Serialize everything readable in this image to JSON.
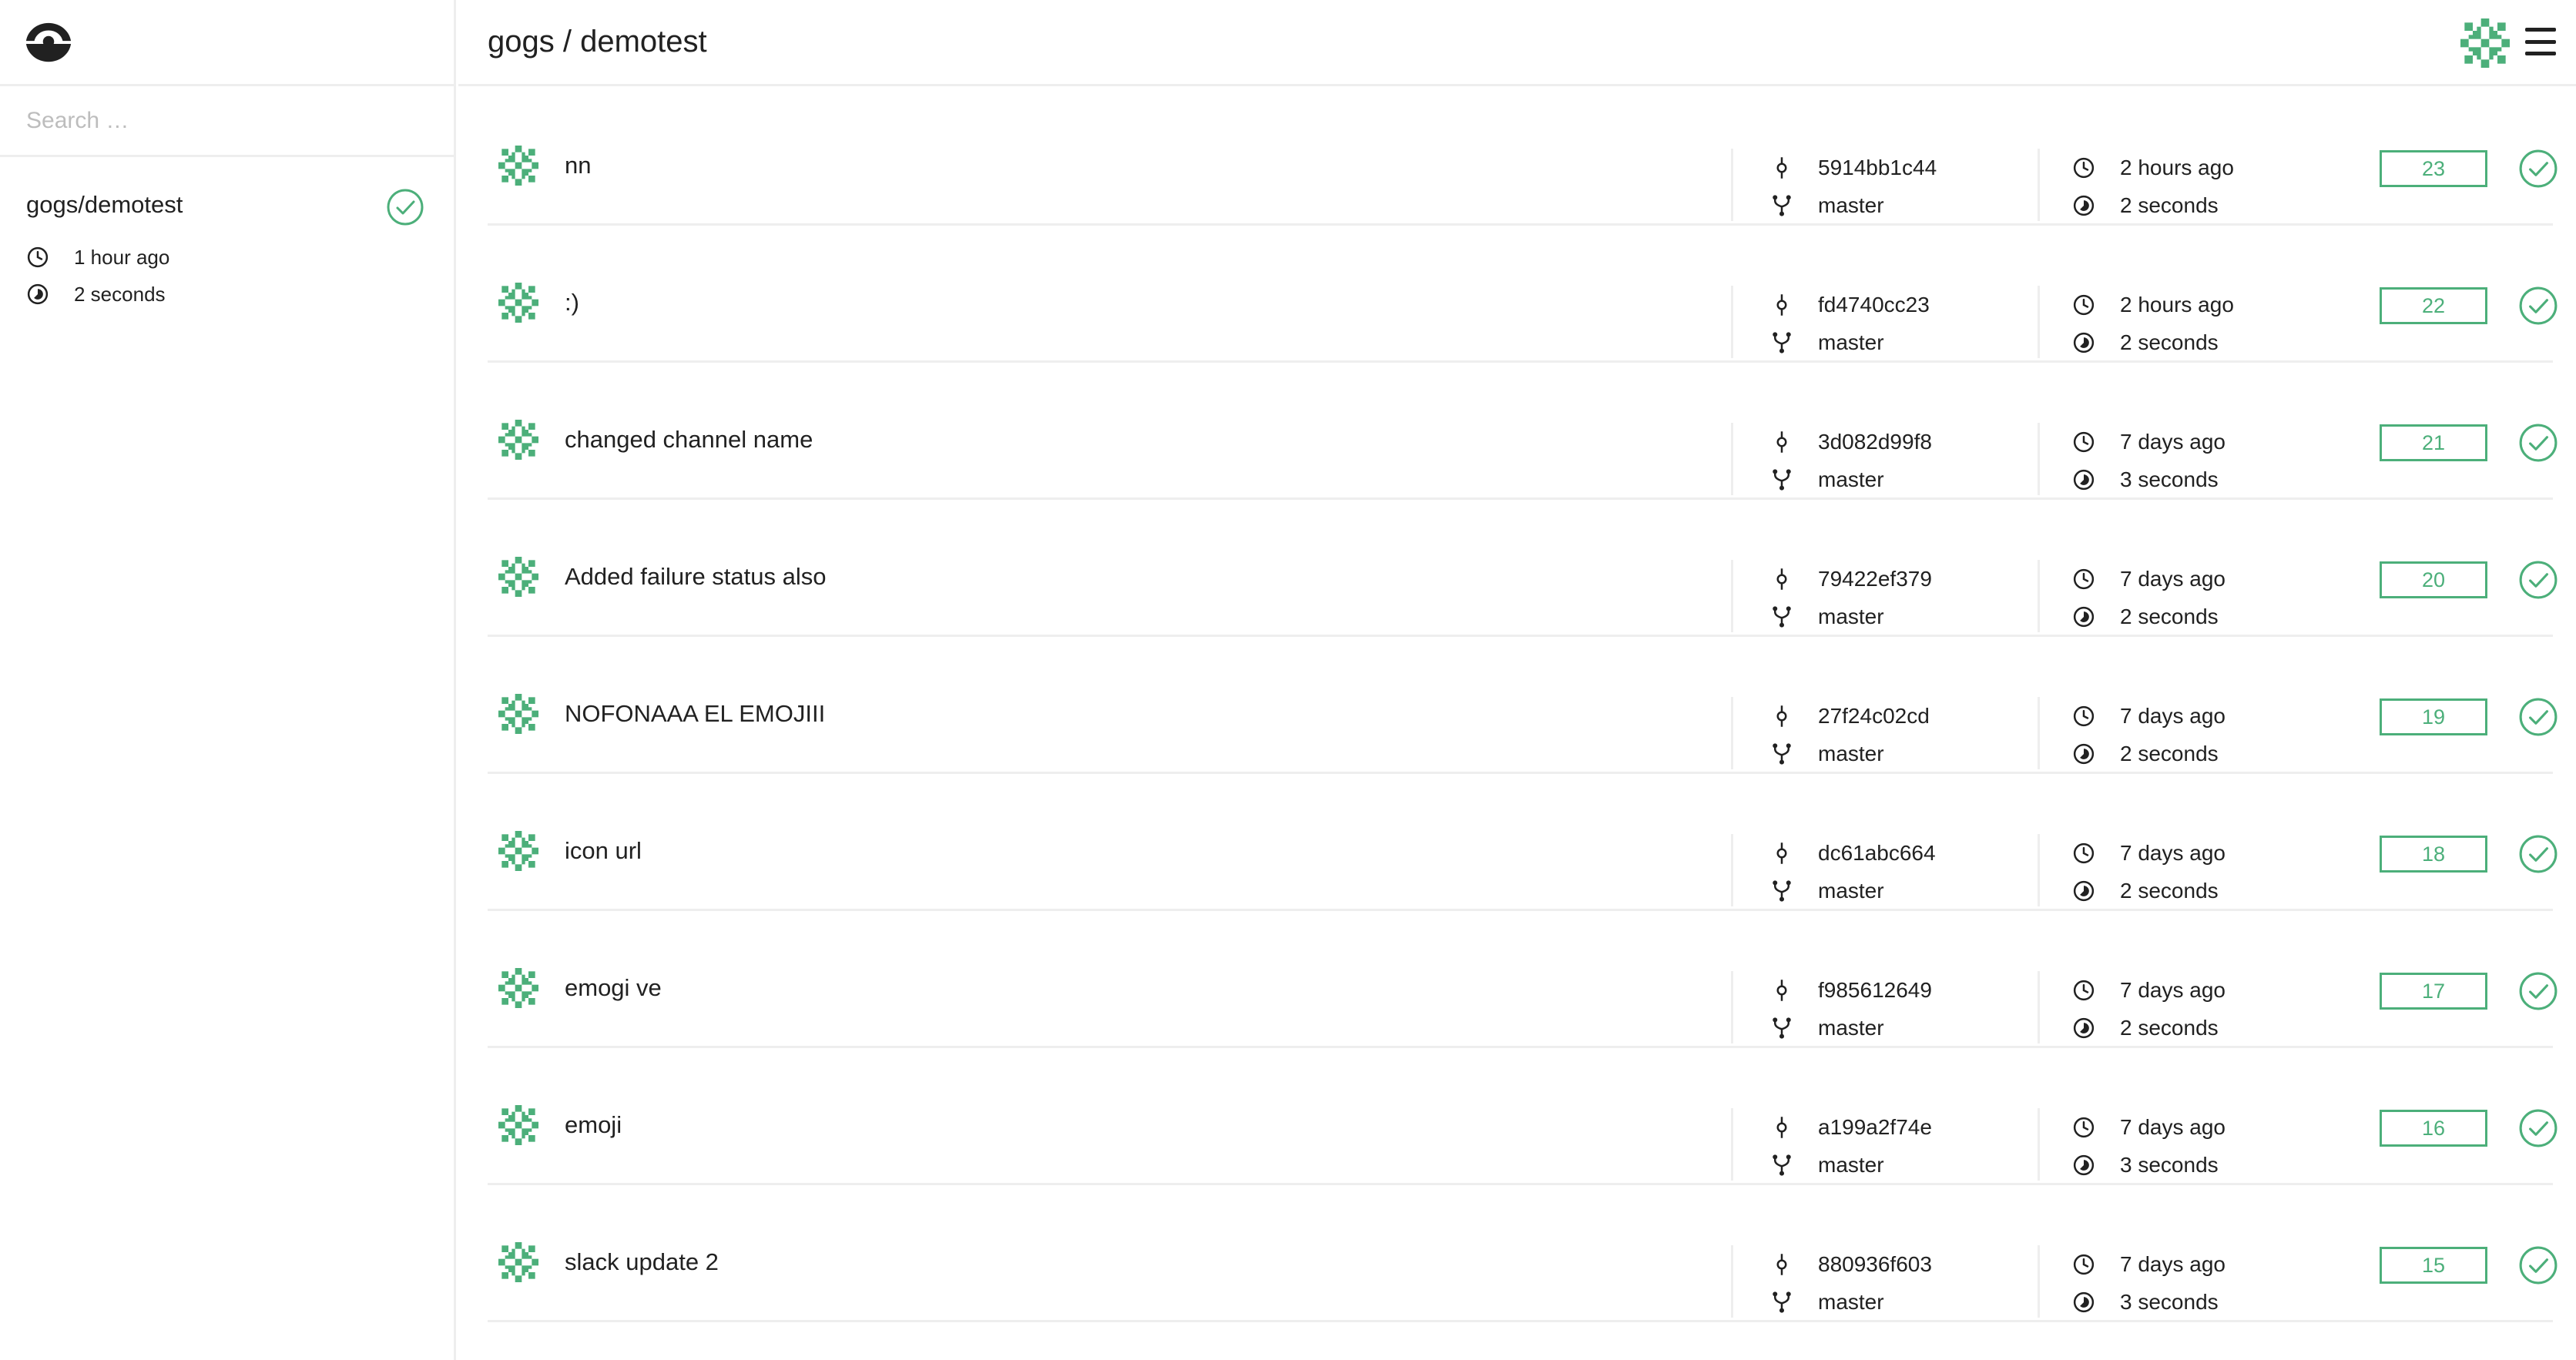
{
  "sidebar": {
    "search_placeholder": "Search …",
    "repos": [
      {
        "name": "gogs/demotest",
        "status": "success",
        "created": "1 hour ago",
        "duration": "2 seconds"
      }
    ]
  },
  "header": {
    "title": "gogs / demotest"
  },
  "colors": {
    "accent": "#4caf7a",
    "divider": "#eeeeee",
    "text": "#212121"
  },
  "builds": [
    {
      "message": "nn",
      "commit": "5914bb1c44",
      "branch": "master",
      "created": "2 hours ago",
      "duration": "2 seconds",
      "number": "23",
      "status": "success"
    },
    {
      "message": ":)",
      "commit": "fd4740cc23",
      "branch": "master",
      "created": "2 hours ago",
      "duration": "2 seconds",
      "number": "22",
      "status": "success"
    },
    {
      "message": "changed channel name",
      "commit": "3d082d99f8",
      "branch": "master",
      "created": "7 days ago",
      "duration": "3 seconds",
      "number": "21",
      "status": "success"
    },
    {
      "message": "Added failure status also",
      "commit": "79422ef379",
      "branch": "master",
      "created": "7 days ago",
      "duration": "2 seconds",
      "number": "20",
      "status": "success"
    },
    {
      "message": "NOFONAAA EL EMOJIII",
      "commit": "27f24c02cd",
      "branch": "master",
      "created": "7 days ago",
      "duration": "2 seconds",
      "number": "19",
      "status": "success"
    },
    {
      "message": "icon url",
      "commit": "dc61abc664",
      "branch": "master",
      "created": "7 days ago",
      "duration": "2 seconds",
      "number": "18",
      "status": "success"
    },
    {
      "message": "emogi ve",
      "commit": "f985612649",
      "branch": "master",
      "created": "7 days ago",
      "duration": "2 seconds",
      "number": "17",
      "status": "success"
    },
    {
      "message": "emoji",
      "commit": "a199a2f74e",
      "branch": "master",
      "created": "7 days ago",
      "duration": "3 seconds",
      "number": "16",
      "status": "success"
    },
    {
      "message": "slack update 2",
      "commit": "880936f603",
      "branch": "master",
      "created": "7 days ago",
      "duration": "3 seconds",
      "number": "15",
      "status": "success"
    }
  ]
}
